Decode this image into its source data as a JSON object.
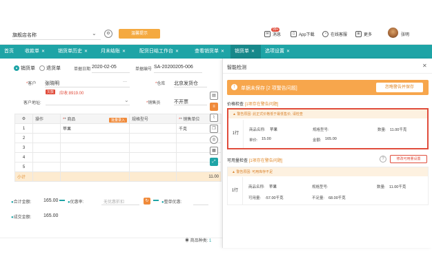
{
  "header": {
    "store": "旗舰店名称",
    "banner": "温馨提示",
    "items": [
      {
        "icon": "mail-icon",
        "label": "消息"
      },
      {
        "icon": "mobile-icon",
        "label": "App下载"
      },
      {
        "icon": "service-icon",
        "label": "在线客服"
      },
      {
        "icon": "grid-icon",
        "label": "更多"
      }
    ],
    "msg_badge": "99+",
    "username": "张明"
  },
  "nav": {
    "tabs": [
      {
        "label": "首页",
        "closable": false
      },
      {
        "label": "收款单",
        "closable": true
      },
      {
        "label": "销货单历史",
        "closable": true
      },
      {
        "label": "月末结账",
        "closable": true
      },
      {
        "label": "配货日结工作台",
        "closable": true
      },
      {
        "label": "查看销货单",
        "closable": true
      },
      {
        "label": "销货单",
        "closable": true,
        "active": true
      },
      {
        "label": "选项设置",
        "closable": true
      }
    ]
  },
  "form": {
    "radio1": "销货单",
    "radio2": "退货单",
    "date_label": "单据日期",
    "date_value": "2020-02-05",
    "no_label": "单据编号",
    "no_value": "SA-20200205-006",
    "customer_label": "客户",
    "customer_value": "张晓明",
    "overdue_badge": "欠款",
    "overdue_amount": "应收:8919.00",
    "warehouse_label": "仓库",
    "warehouse_value": "北京发货仓",
    "customer_attr_label": "客户地址:",
    "sales_label": "销售员",
    "sales_value": "不开票",
    "more": "···",
    "table": {
      "headers": [
        "序",
        "操作",
        "* 商品",
        "批量录入",
        "规格型号",
        "* 销售单位"
      ],
      "rows": [
        {
          "idx": "1",
          "product": "苹果",
          "spec": "",
          "unit": "千克"
        },
        {
          "idx": "2",
          "product": "",
          "spec": "",
          "unit": ""
        },
        {
          "idx": "3",
          "product": "",
          "spec": "",
          "unit": ""
        },
        {
          "idx": "4",
          "product": "",
          "spec": "",
          "unit": ""
        },
        {
          "idx": "5",
          "product": "",
          "spec": "",
          "unit": ""
        }
      ],
      "subtotal_label": "小计",
      "subtotal_value": "11.00"
    },
    "summary": {
      "total_label": "合计金额:",
      "total_value": "165.00",
      "discount_label": "优惠率:",
      "discount_placeholder": "无优惠折扣",
      "discount_amount_label": "整单优惠:",
      "final_label": "成交金额:",
      "final_value": "165.00"
    }
  },
  "footer": {
    "product_kinds_label": "商品种类:",
    "product_kinds_value": "1"
  },
  "panel": {
    "title": "智能检测",
    "alert": "单据未保存 [2 项警告问题]",
    "alert_button": "忽略警告并保存",
    "price_title": "价格检查",
    "price_note": "[1项存在警告问题]",
    "price_warn": "警告原因: 此正式价格低于最低售价, 请检查",
    "price_row": {
      "idx": "1行",
      "name_label": "商品名称:",
      "name_value": "苹果",
      "spec_label": "规格型号:",
      "spec_value": "",
      "qty_label": "数量:",
      "qty_value": "11.00千克",
      "price_label": "单价:",
      "price_value": "15.00",
      "amount_label": "金额:",
      "amount_value": "165.00"
    },
    "stock_title": "可用量检查",
    "stock_note": "[1项存在警告问题]",
    "stock_help": "?",
    "stock_button": "修改可用量设置",
    "stock_warn": "警告原因: 可用库存不足",
    "stock_row": {
      "idx": "1行",
      "name_label": "商品名称:",
      "name_value": "苹果",
      "spec_label": "规格型号:",
      "spec_value": "",
      "qty_label": "数量:",
      "qty_value": "11.00千克",
      "avail_label": "可用量:",
      "avail_value": "-57.00千克",
      "short_label": "不足量:",
      "short_value": "68.00千克"
    }
  }
}
